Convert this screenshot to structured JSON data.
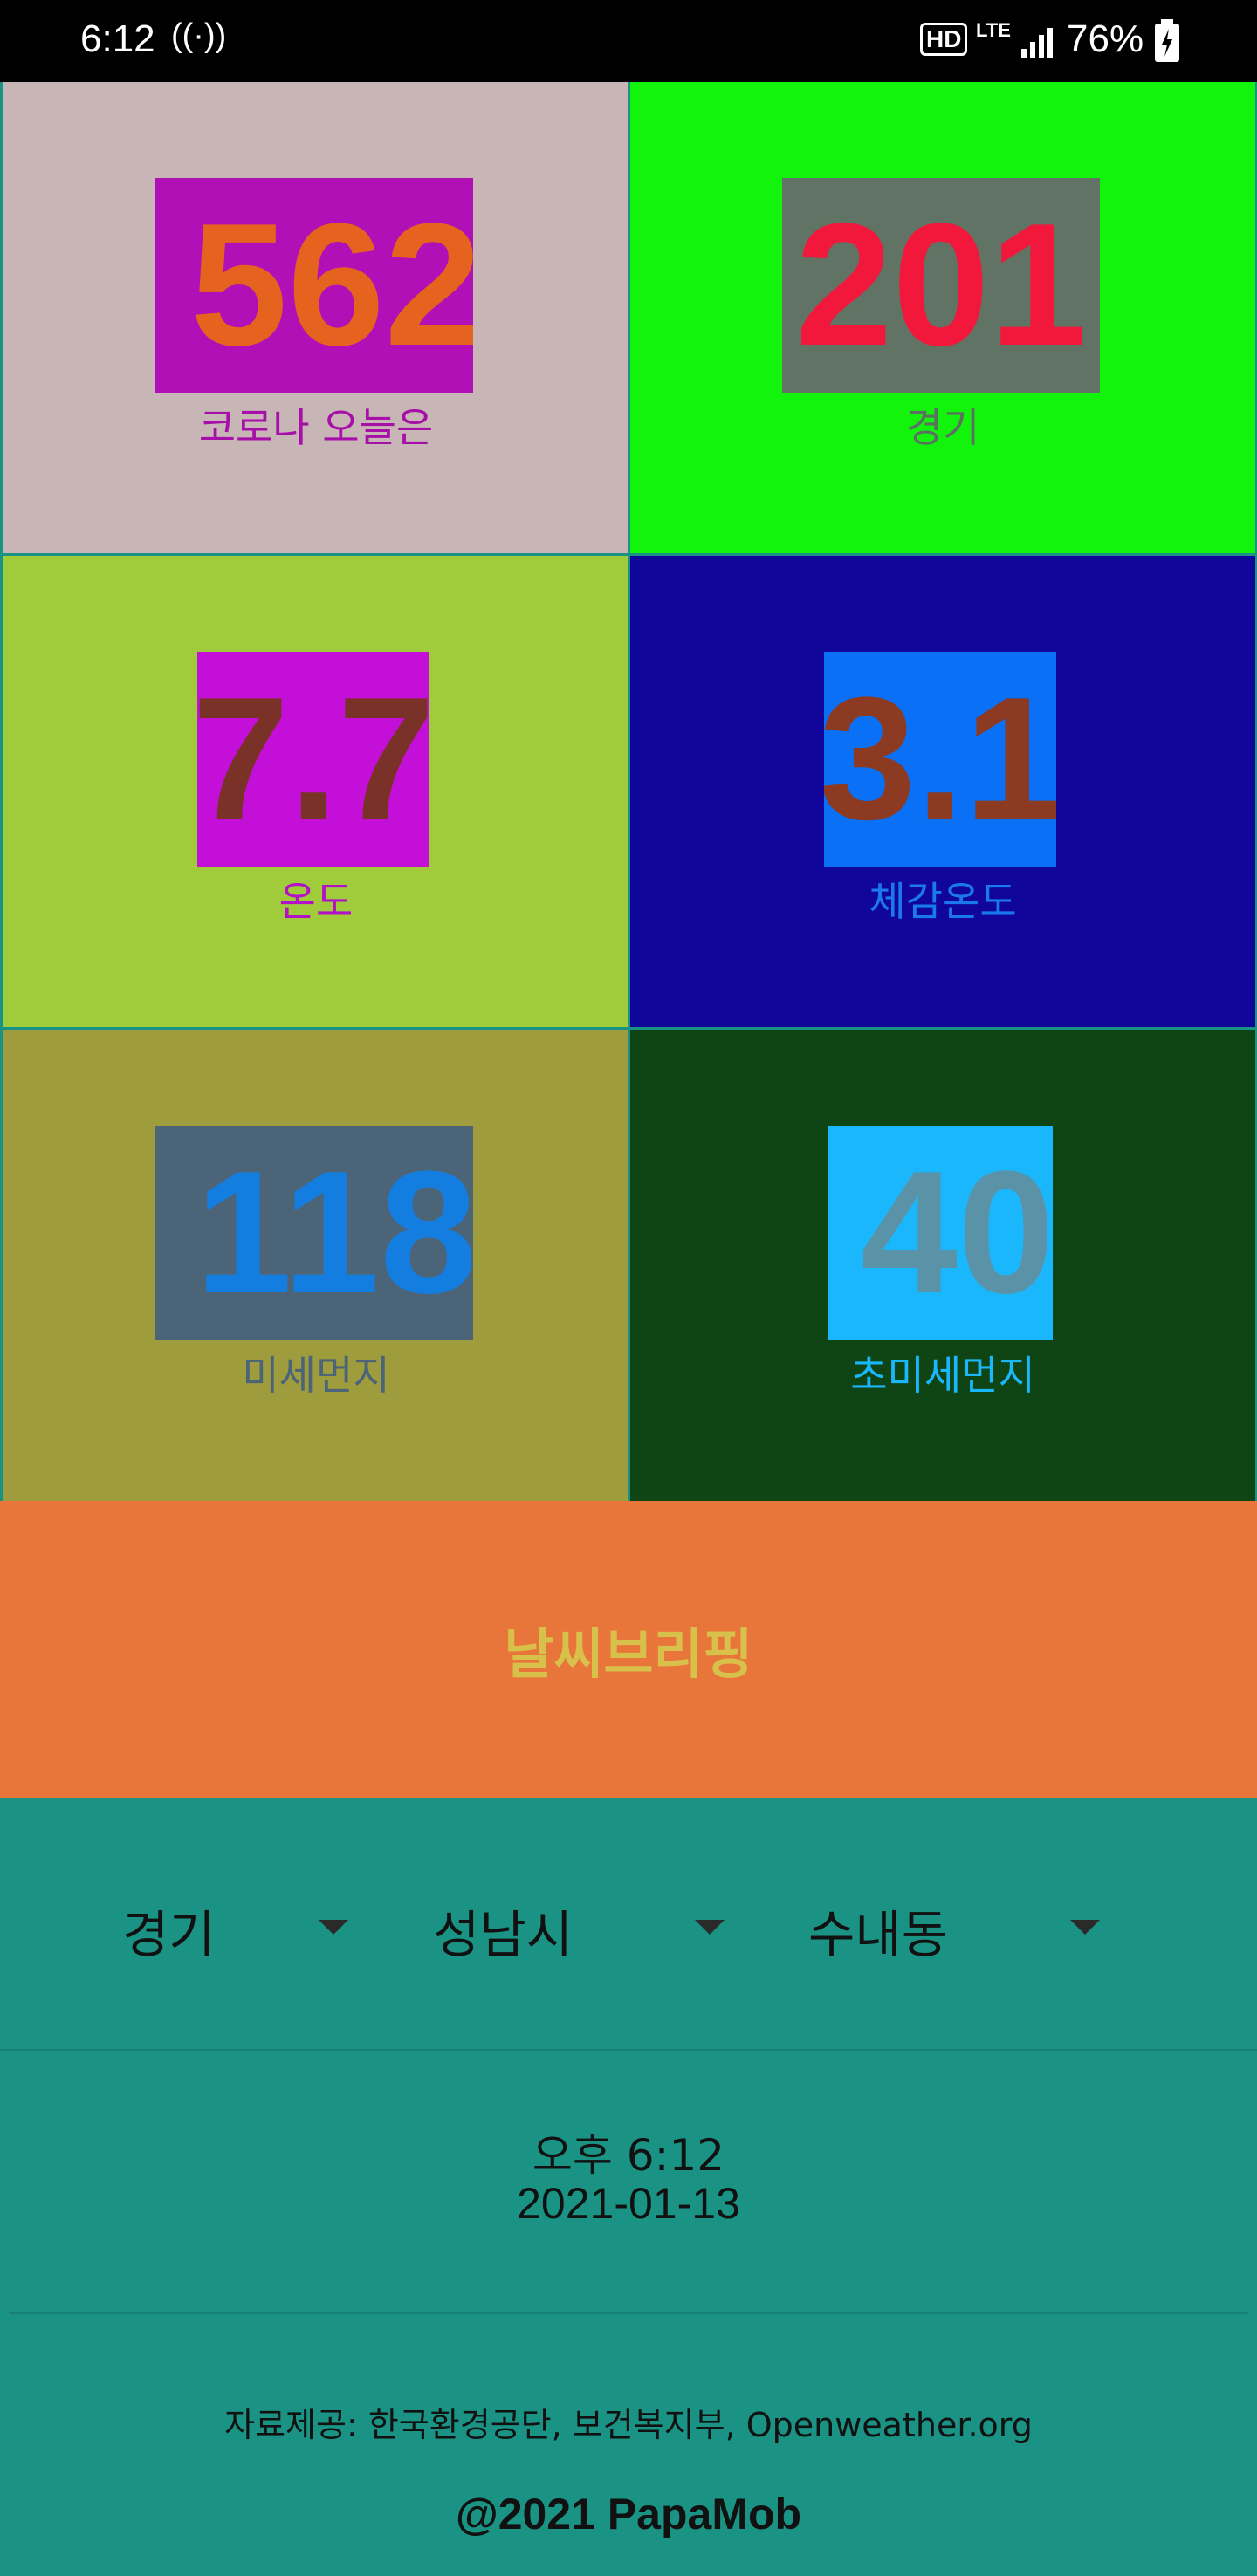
{
  "status_bar": {
    "time": "6:12",
    "network_icon": "wifi-calling-icon",
    "hd_label": "HD",
    "lte_label": "LTE",
    "signal_icon": "signal-bars-icon",
    "battery": "76%",
    "battery_icon": "battery-charging-icon"
  },
  "tiles": [
    {
      "value": "562",
      "label": "코로나 오늘은",
      "bg": "#c8b5b5",
      "box": "#b010b5",
      "num_color": "#e6621f",
      "label_color": "#a610a8"
    },
    {
      "value": "201",
      "label": "경기",
      "bg": "#13f40d",
      "box": "#607365",
      "num_color": "#f2183c",
      "label_color": "#5a7060"
    },
    {
      "value": "7.7",
      "label": "온도",
      "bg": "#a0cc3c",
      "box": "#c40fd8",
      "num_color": "#7a3228",
      "label_color": "#b410c8"
    },
    {
      "value": "3.1",
      "label": "체감온도",
      "bg": "#10069a",
      "box": "#0a70f5",
      "num_color": "#8c3a22",
      "label_color": "#1b79f0"
    },
    {
      "value": "118",
      "label": "미세먼지",
      "bg": "#9f9c3e",
      "box": "#4b6477",
      "num_color": "#137ee0",
      "label_color": "#4b6477"
    },
    {
      "value": "40",
      "label": "초미세먼지",
      "bg": "#0f4514",
      "box": "#1ab7fd",
      "num_color": "#5a93a8",
      "label_color": "#1ab7fd"
    }
  ],
  "briefing": {
    "label": "날씨브리핑"
  },
  "selectors": [
    {
      "value": "경기"
    },
    {
      "value": "성남시"
    },
    {
      "value": "수내동"
    }
  ],
  "datetime": {
    "time": "오후 6:12",
    "date": "2021-01-13"
  },
  "footer": {
    "source": "자료제공: 한국환경공단, 보건복지부, Openweather.org",
    "copyright": "@2021 PapaMob"
  }
}
